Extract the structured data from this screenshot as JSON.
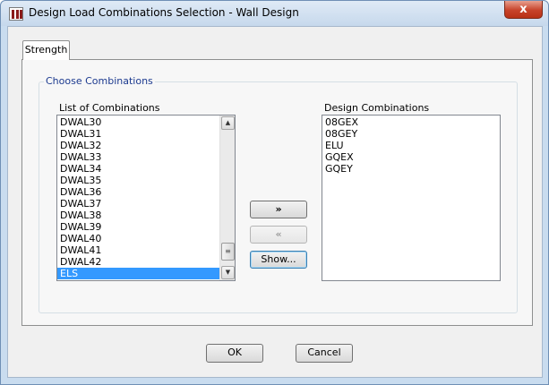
{
  "window": {
    "title": "Design Load Combinations Selection - Wall Design",
    "close_glyph": "x"
  },
  "tabs": [
    {
      "label": "Strength"
    }
  ],
  "group": {
    "legend": "Choose Combinations"
  },
  "list_of_combinations": {
    "label": "List of Combinations",
    "items": [
      "DWAL30",
      "DWAL31",
      "DWAL32",
      "DWAL33",
      "DWAL34",
      "DWAL35",
      "DWAL36",
      "DWAL37",
      "DWAL38",
      "DWAL39",
      "DWAL40",
      "DWAL41",
      "DWAL42",
      "ELS"
    ],
    "selected_item": "ELS"
  },
  "design_combinations": {
    "label": "Design Combinations",
    "items": [
      "08GEX",
      "08GEY",
      "ELU",
      "GQEX",
      "GQEY"
    ]
  },
  "transfer_buttons": {
    "add_label": "»",
    "remove_label": "«",
    "show_label": "Show..."
  },
  "footer": {
    "ok_label": "OK",
    "cancel_label": "Cancel"
  },
  "colors": {
    "selection": "#3399ff",
    "legend_text": "#1c3a8f",
    "close_button": "#c7432a"
  }
}
